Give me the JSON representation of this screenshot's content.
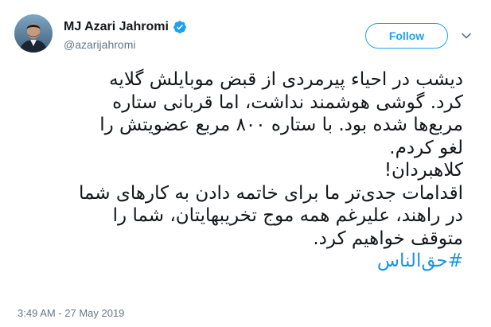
{
  "author": {
    "display_name": "MJ Azari Jahromi",
    "handle": "@azarijahromi",
    "verified": true
  },
  "follow_button": {
    "label": "Follow"
  },
  "tweet": {
    "lines": [
      "دیشب در احیاء پیرمردی از قبض موبایلش گلایه",
      "کرد. گوشی هوشمند نداشت، اما قربانی ستاره",
      "مربع‌ها شده بود. با ستاره ۸۰۰ مربع عضویتش را",
      "لغو کردم.",
      "کلاهبردان!",
      "اقدامات جدی‌تر ما برای خاتمه دادن به کارهای شما",
      "در راهند، علیرغم همه موج تخریبهایتان، شما را",
      "متوقف خواهیم کرد."
    ],
    "hashtag": "#حق‌الناس"
  },
  "timestamp": "3:49 AM - 27 May 2019",
  "colors": {
    "accent": "#1da1f2",
    "link": "#1b95e0",
    "secondary_text": "#657786",
    "primary_text": "#14171a"
  },
  "icons": {
    "verified": "verified-badge-icon",
    "caret": "chevron-down-icon",
    "avatar": "profile-photo"
  }
}
